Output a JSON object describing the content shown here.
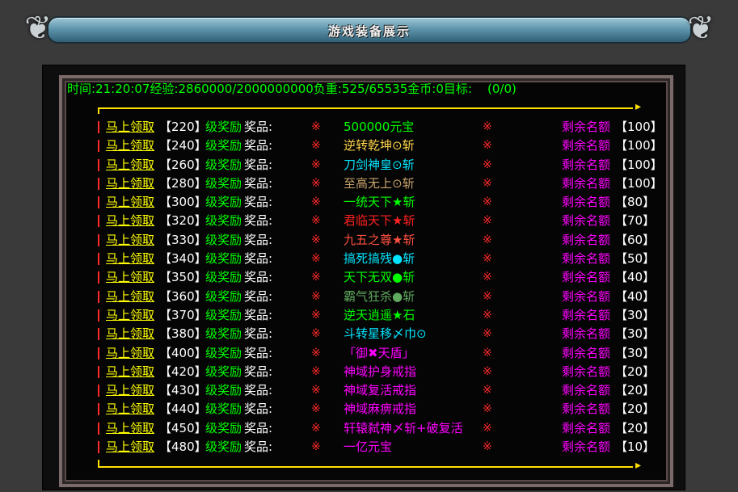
{
  "title": "游戏装备展示",
  "status": {
    "time_label": "时间:",
    "time": "21:20:07",
    "exp_label": "经验:",
    "exp": "2860000/2000000000",
    "load_label": "负重:",
    "load": "525/65535",
    "gold_label": "金币:",
    "gold": "0",
    "target_label": "目标:",
    "target": "(0/0)"
  },
  "claim_label": "马上领取",
  "level_suffix": "级奖励",
  "prize_label": "奖品:",
  "mark": "※",
  "remain_label": "剩余名额",
  "colors": {
    "claim": "#ffff00",
    "status": "#00ff00",
    "mark": "#ff2a2a",
    "remain": "#ff00ff"
  },
  "rows": [
    {
      "level": "【220】",
      "prize": "500000元宝",
      "prize_color": "#00ff00",
      "qty": "【100】"
    },
    {
      "level": "【240】",
      "prize": "逆转乾坤⊙斩",
      "prize_color": "#ffd54a",
      "qty": "【100】"
    },
    {
      "level": "【260】",
      "prize": "刀剑神皇⊙斩",
      "prize_color": "#00e5ff",
      "qty": "【100】"
    },
    {
      "level": "【280】",
      "prize": "至高无上⊙斩",
      "prize_color": "#c9a36b",
      "qty": "【100】"
    },
    {
      "level": "【300】",
      "prize": "一统天下★斩",
      "prize_color": "#00ff00",
      "qty": "【80】"
    },
    {
      "level": "【320】",
      "prize": "君临天下★斩",
      "prize_color": "#ff2020",
      "qty": "【70】"
    },
    {
      "level": "【330】",
      "prize": "九五之尊★斩",
      "prize_color": "#ff5040",
      "qty": "【60】"
    },
    {
      "level": "【340】",
      "prize": "搞死搞残●斩",
      "prize_color": "#00e5ff",
      "qty": "【50】"
    },
    {
      "level": "【350】",
      "prize": "天下无双●斩",
      "prize_color": "#00ff00",
      "qty": "【40】"
    },
    {
      "level": "【360】",
      "prize": "霸气狂杀●斩",
      "prize_color": "#5faa5f",
      "qty": "【40】"
    },
    {
      "level": "【370】",
      "prize": "逆天逍遥★石",
      "prize_color": "#00ff00",
      "qty": "【30】"
    },
    {
      "level": "【380】",
      "prize": "斗转星移〆巾⊙",
      "prize_color": "#00e5ff",
      "qty": "【30】"
    },
    {
      "level": "【400】",
      "prize": "「御✖天盾」",
      "prize_color": "#ff00ff",
      "qty": "【30】"
    },
    {
      "level": "【420】",
      "prize": "神域护身戒指",
      "prize_color": "#ff00ff",
      "qty": "【20】"
    },
    {
      "level": "【430】",
      "prize": "神域复活戒指",
      "prize_color": "#ff00ff",
      "qty": "【20】"
    },
    {
      "level": "【440】",
      "prize": "神域麻痹戒指",
      "prize_color": "#ff00ff",
      "qty": "【20】"
    },
    {
      "level": "【450】",
      "prize": "轩辕弑神〆斩+破复活",
      "prize_color": "#ff00ff",
      "qty": "【20】"
    },
    {
      "level": "【480】",
      "prize": "一亿元宝",
      "prize_color": "#ff00ff",
      "qty": "【10】"
    }
  ]
}
